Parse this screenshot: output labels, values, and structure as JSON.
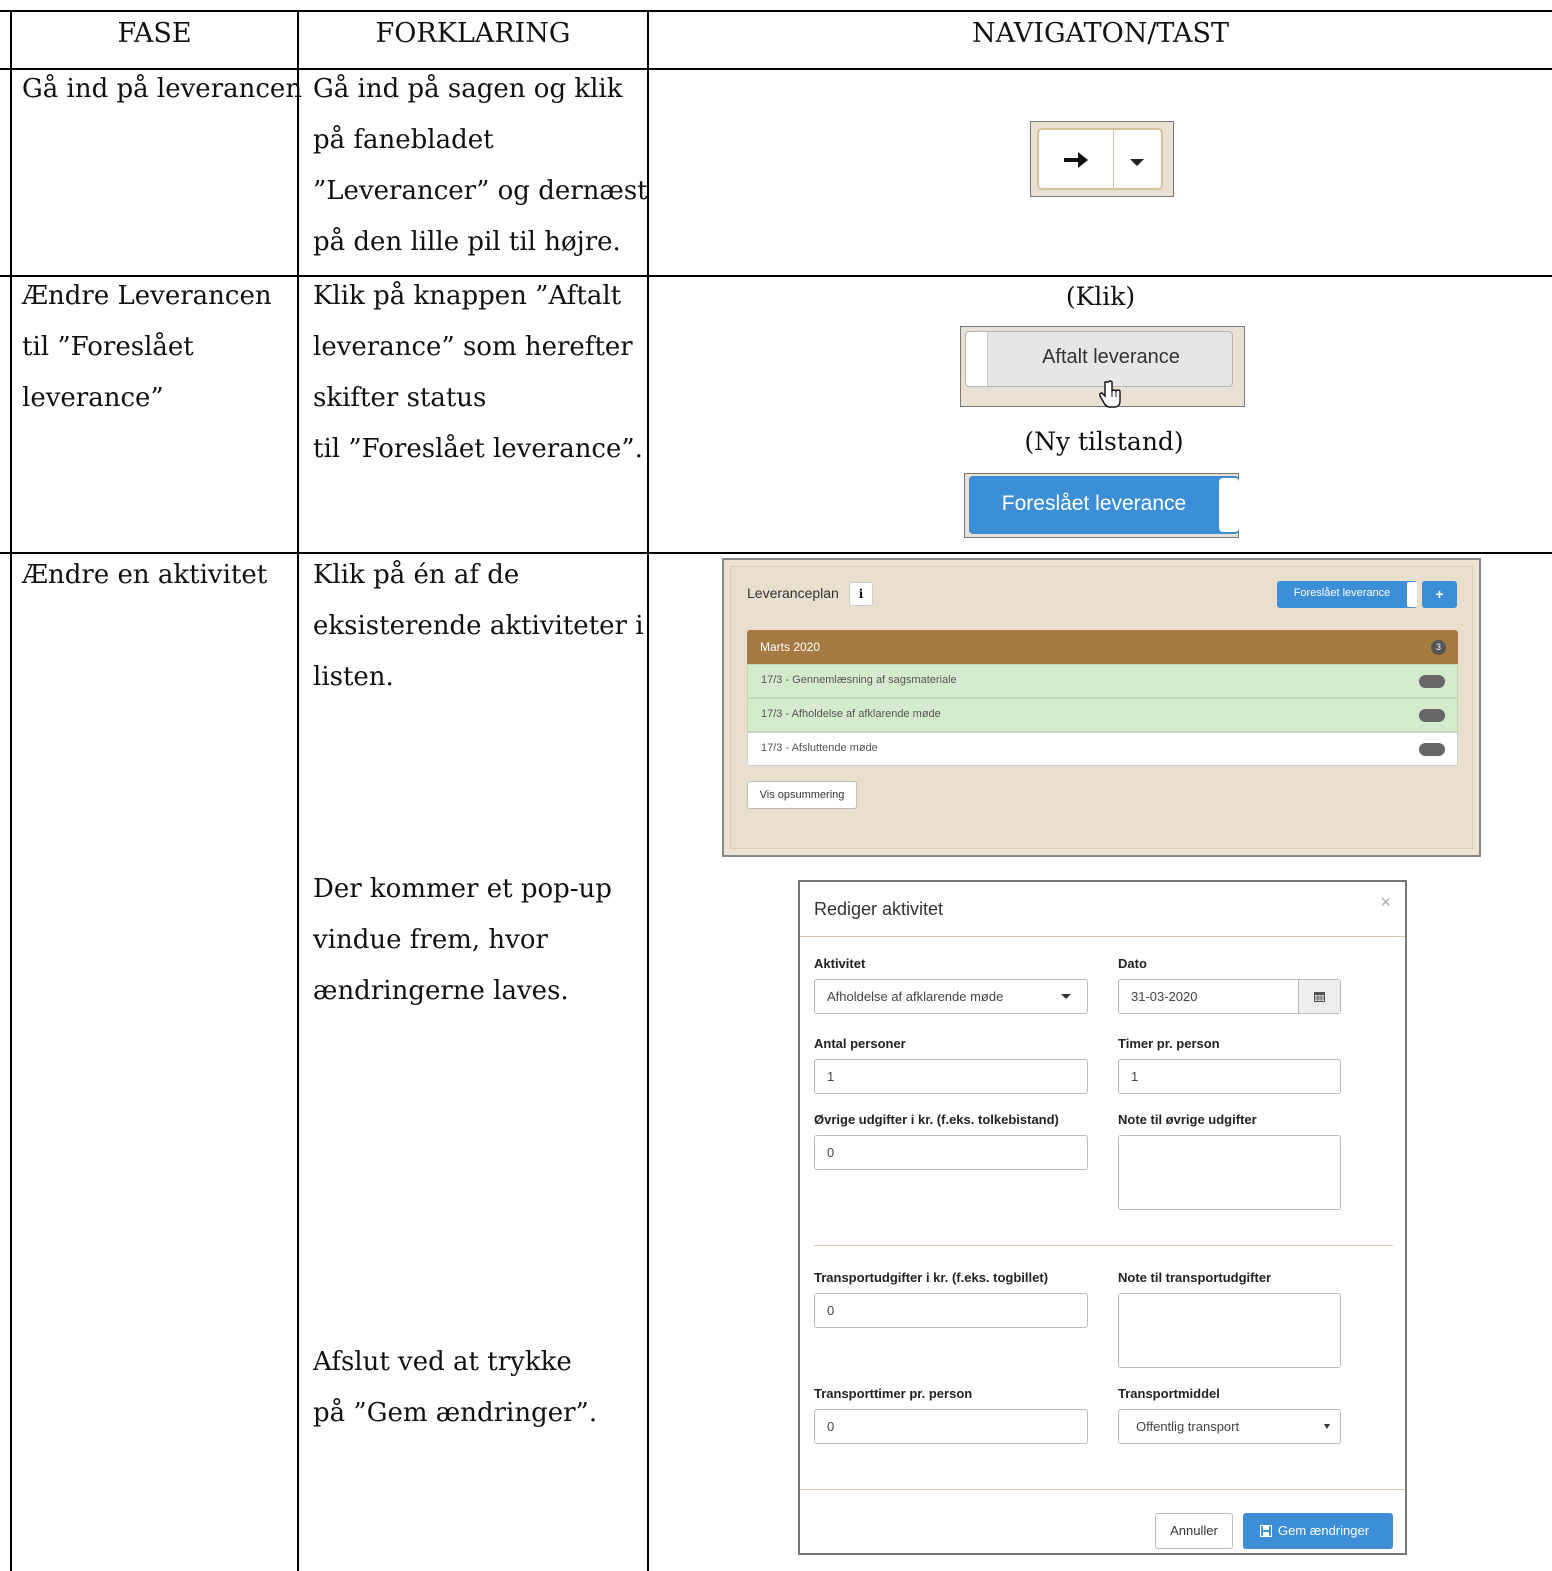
{
  "headers": {
    "fase": "FASE",
    "forklaring": "FORKLARING",
    "navigation": "NAVIGATON/TAST"
  },
  "rows": [
    {
      "fase": [
        "Gå ind på leverancen"
      ],
      "forklaring": [
        "Gå ind på sagen og klik",
        "på fanebladet",
        "”Leverancer” og dernæst",
        "på den lille pil til højre."
      ]
    },
    {
      "fase": [
        "Ændre Leverancen",
        "til ”Foreslået",
        "leverance”"
      ],
      "forklaring": [
        "Klik på knappen ”Aftalt",
        "leverance” som herefter",
        "skifter status",
        "til ”Foreslået leverance”."
      ]
    },
    {
      "fase": [
        "Ændre en aktivitet"
      ],
      "forklaring": [
        "Klik på én af de",
        "eksisterende aktiviteter i",
        "listen."
      ],
      "forklaring2": [
        "Der kommer et pop-up",
        "vindue frem, hvor",
        "ændringerne laves."
      ],
      "forklaring3": [
        "Afslut ved at trykke",
        "på ”Gem ændringer”."
      ]
    }
  ],
  "nav": {
    "arrow_icon": "arrow-right-icon",
    "caret_icon": "caret-down-icon",
    "klik_caption": "(Klik)",
    "aftalt_label": "Aftalt leverance",
    "ny_caption": "(Ny tilstand)",
    "foreslaet_label": "Foreslået leverance"
  },
  "plan": {
    "title": "Leveranceplan",
    "info": "i",
    "status_button": "Foreslået leverance",
    "add": "+",
    "month": "Marts 2020",
    "count": "3",
    "items": [
      {
        "label": "17/3 - Gennemlæsning af sagsmateriale",
        "status": "green"
      },
      {
        "label": "17/3 - Afholdelse af afklarende møde",
        "status": "green"
      },
      {
        "label": "17/3 - Afsluttende møde",
        "status": "white"
      }
    ],
    "summary_button": "Vis opsummering"
  },
  "modal": {
    "title": "Rediger aktivitet",
    "close": "×",
    "aktivitet_label": "Aktivitet",
    "aktivitet_value": "Afholdelse af afklarende møde",
    "dato_label": "Dato",
    "dato_value": "31-03-2020",
    "antal_label": "Antal personer",
    "antal_value": "1",
    "timer_label": "Timer pr. person",
    "timer_value": "1",
    "ovrige_label": "Øvrige udgifter i kr. (f.eks. tolkebistand)",
    "ovrige_value": "0",
    "note_ovrige_label": "Note til øvrige udgifter",
    "transport_label": "Transportudgifter i kr. (f.eks. togbillet)",
    "transport_value": "0",
    "note_transport_label": "Note til transportudgifter",
    "transporttimer_label": "Transporttimer pr. person",
    "transporttimer_value": "0",
    "transportmiddel_label": "Transportmiddel",
    "transportmiddel_value": "Offentlig transport",
    "cancel": "Annuller",
    "save": "Gem ændringer"
  },
  "colors": {
    "accent": "#3c8fd6",
    "month_bar": "#a67b41",
    "row_green": "#d5ebcd",
    "panel_bg": "#e9dfce"
  }
}
